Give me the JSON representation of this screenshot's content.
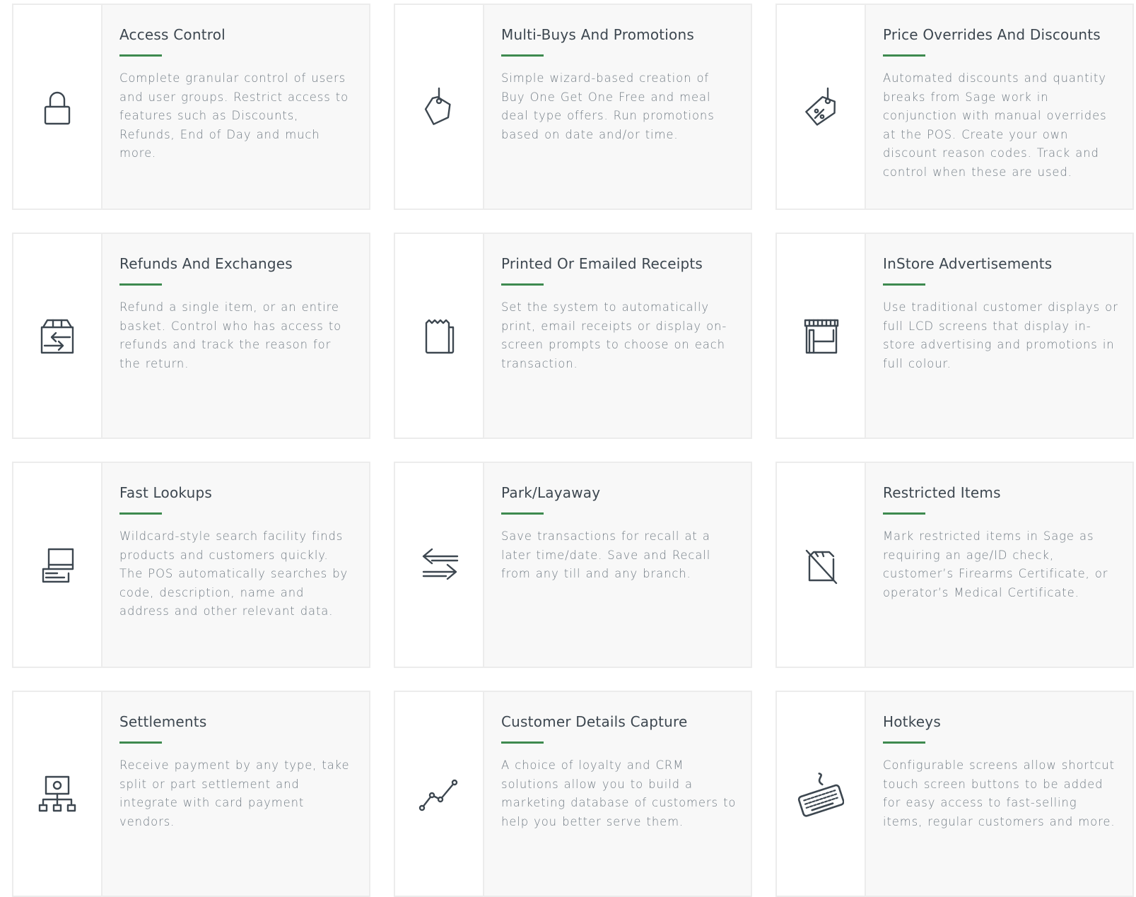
{
  "features": [
    {
      "title": "Access Control",
      "description": "Complete granular control of users and user groups.  Restrict access to features such as Discounts, Refunds, End of Day and much more.",
      "icon": "padlock-icon"
    },
    {
      "title": "Multi-Buys And Promotions",
      "description": "Simple wizard-based creation of Buy One Get One Free and meal deal type offers. Run promotions based on date and/or time.",
      "icon": "price-tag-icon"
    },
    {
      "title": "Price Overrides And Discounts",
      "description": "Automated discounts and quantity breaks from Sage work in conjunction with manual overrides at the POS. Create your own discount reason codes. Track and control when these are used.",
      "icon": "percent-tag-icon"
    },
    {
      "title": "Refunds And Exchanges",
      "description": "Refund a single item, or an entire basket. Control who has access to refunds and track the reason for the return.",
      "icon": "exchange-box-icon"
    },
    {
      "title": "Printed Or Emailed Receipts",
      "description": "Set the system to automatically print, email receipts or display on-screen prompts to choose on each transaction.",
      "icon": "receipt-icon"
    },
    {
      "title": "InStore Advertisements",
      "description": "Use traditional customer displays or full LCD screens that display in-store advertising and promotions in full colour.",
      "icon": "storefront-icon"
    },
    {
      "title": "Fast Lookups",
      "description": "Wildcard-style search facility finds products and customers quickly. The POS automatically searches by code, description, name and address and other relevant data.",
      "icon": "monitors-icon"
    },
    {
      "title": "Park/Layaway",
      "description": "Save transactions for recall at a later time/date. Save and Recall from any till and any branch.",
      "icon": "swap-arrows-icon"
    },
    {
      "title": "Restricted Items",
      "description": "Mark restricted items in Sage as requiring an age/ID check, customer’s Firearms Certificate, or operator’s Medical Certificate.",
      "icon": "restricted-box-icon"
    },
    {
      "title": "Settlements",
      "description": "Receive payment by any type, take split or part settlement and integrate with card payment vendors.",
      "icon": "network-icon"
    },
    {
      "title": "Customer Details Capture",
      "description": "A choice of loyalty and CRM solutions allow you to build a marketing database of customers to help you better serve them.",
      "icon": "line-graph-icon"
    },
    {
      "title": "Hotkeys",
      "description": "Configurable screens allow shortcut touch screen buttons to be added for easy access to fast-selling items, regular customers and more.",
      "icon": "keyboard-icon"
    }
  ],
  "colors": {
    "accent": "#3e8a4f",
    "heading": "#3d4750",
    "text": "#717b84",
    "panel": "#f8f8f8",
    "border": "#ececec"
  }
}
